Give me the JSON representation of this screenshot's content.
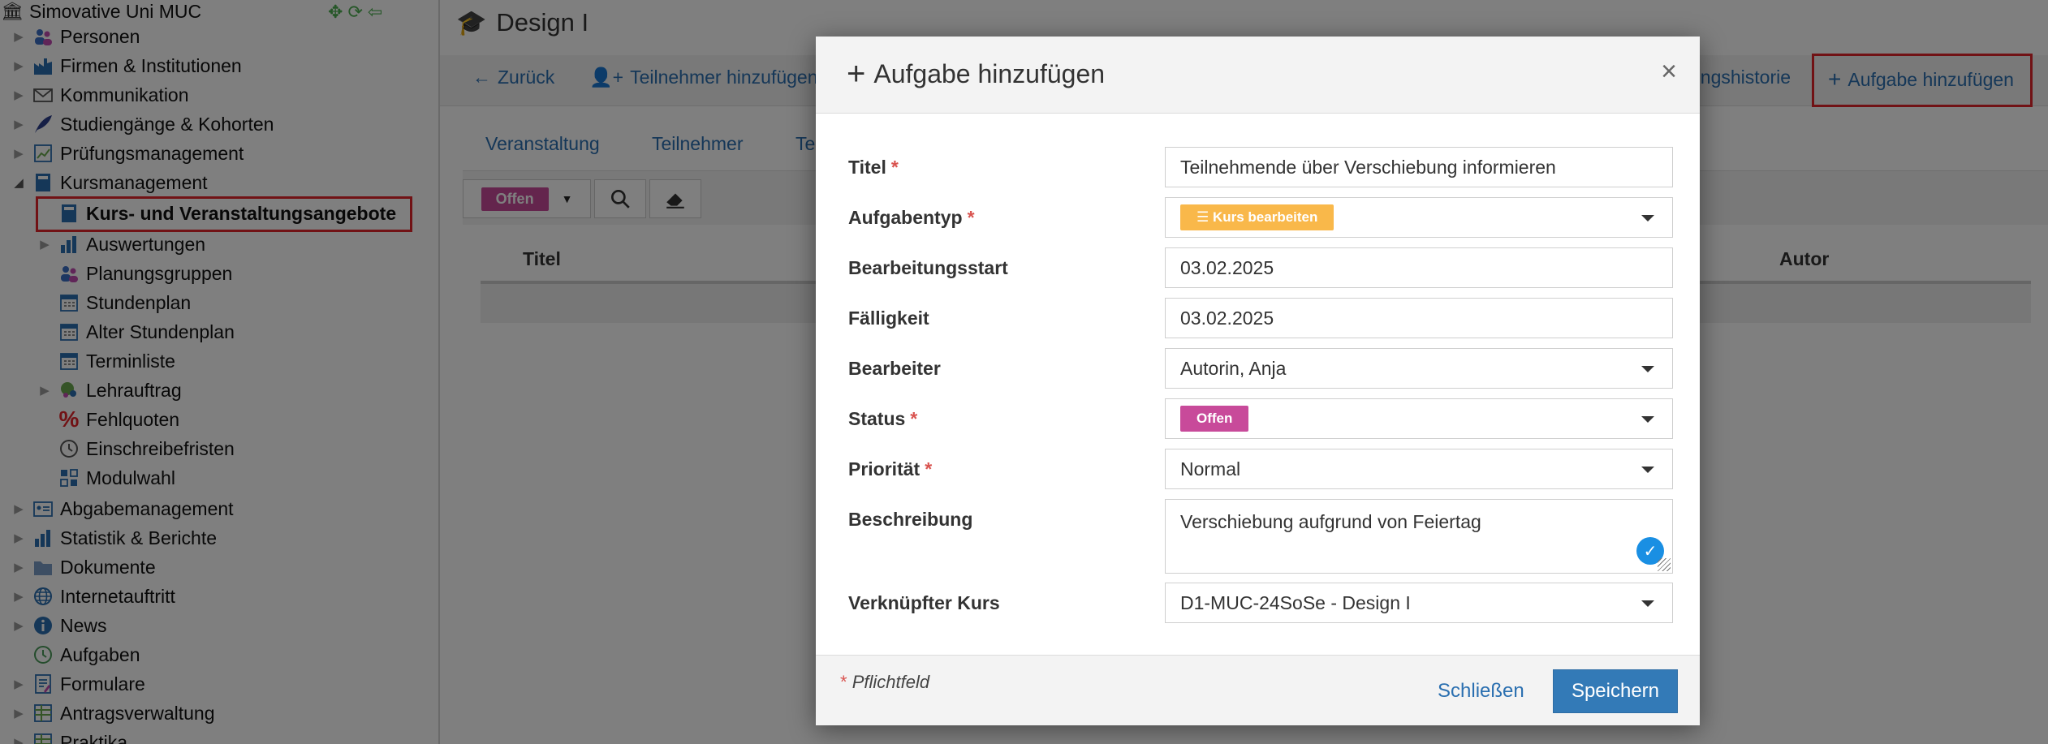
{
  "sidebar": {
    "root_label": "Simovative Uni MUC",
    "items": [
      {
        "label": "Personen",
        "icon": "people-icon"
      },
      {
        "label": "Firmen & Institutionen",
        "icon": "factory-icon"
      },
      {
        "label": "Kommunikation",
        "icon": "envelope-icon"
      },
      {
        "label": "Studiengänge & Kohorten",
        "icon": "quill-icon"
      },
      {
        "label": "Prüfungsmanagement",
        "icon": "exam-chart-icon"
      },
      {
        "label": "Kursmanagement",
        "icon": "book-icon"
      },
      {
        "label": "Kurs- und Veranstaltungsangebote",
        "icon": "book-icon"
      },
      {
        "label": "Auswertungen",
        "icon": "bar-chart-icon"
      },
      {
        "label": "Planungsgruppen",
        "icon": "people-icon"
      },
      {
        "label": "Stundenplan",
        "icon": "calendar-icon"
      },
      {
        "label": "Alter Stundenplan",
        "icon": "calendar-icon"
      },
      {
        "label": "Terminliste",
        "icon": "calendar-icon"
      },
      {
        "label": "Lehrauftrag",
        "icon": "globe-people-icon"
      },
      {
        "label": "Fehlquoten",
        "icon": "percent-icon"
      },
      {
        "label": "Einschreibefristen",
        "icon": "clock-icon"
      },
      {
        "label": "Modulwahl",
        "icon": "modules-icon"
      },
      {
        "label": "Abgabemanagement",
        "icon": "id-card-icon"
      },
      {
        "label": "Statistik & Berichte",
        "icon": "bar-chart-icon"
      },
      {
        "label": "Dokumente",
        "icon": "folder-icon"
      },
      {
        "label": "Internetauftritt",
        "icon": "globe-icon"
      },
      {
        "label": "News",
        "icon": "info-icon"
      },
      {
        "label": "Aufgaben",
        "icon": "history-icon"
      },
      {
        "label": "Formulare",
        "icon": "form-icon"
      },
      {
        "label": "Antragsverwaltung",
        "icon": "table-icon"
      },
      {
        "label": "Praktika",
        "icon": "table-icon"
      }
    ]
  },
  "main": {
    "title": "Design I",
    "toolbar": {
      "back": "Zurück",
      "add_participant": "Teilnehmer hinzufügen",
      "history_fragment": "ungshistorie",
      "add_task": "Aufgabe hinzufügen"
    },
    "tabs": [
      "Veranstaltung",
      "Teilnehmer",
      "Te"
    ],
    "filter_status": "Offen",
    "columns": [
      "Titel",
      "Autor"
    ]
  },
  "modal": {
    "title": "Aufgabe hinzufügen",
    "close": "×",
    "fields": {
      "titel": {
        "label": "Titel",
        "value": "Teilnehmende über Verschiebung informieren"
      },
      "aufgabentyp": {
        "label": "Aufgabentyp",
        "value": "Kurs bearbeiten"
      },
      "start": {
        "label": "Bearbeitungsstart",
        "value": "03.02.2025"
      },
      "faelligkeit": {
        "label": "Fälligkeit",
        "value": "03.02.2025"
      },
      "bearbeiter": {
        "label": "Bearbeiter",
        "value": "Autorin, Anja"
      },
      "status": {
        "label": "Status",
        "value": "Offen"
      },
      "prioritaet": {
        "label": "Priorität",
        "value": "Normal"
      },
      "beschreibung": {
        "label": "Beschreibung",
        "value": "Verschiebung aufgrund von Feiertag"
      },
      "kurs": {
        "label": "Verknüpfter Kurs",
        "value": "D1-MUC-24SoSe - Design I"
      }
    },
    "required_marker": "*",
    "required_note": "Pflichtfeld",
    "close_button": "Schließen",
    "save_button": "Speichern"
  },
  "colors": {
    "link_blue": "#2a6fb0",
    "primary_blue": "#337ab7",
    "status_offen": "#c84a9a",
    "type_kurs": "#f9b84a",
    "highlight_red": "#e3242b"
  }
}
